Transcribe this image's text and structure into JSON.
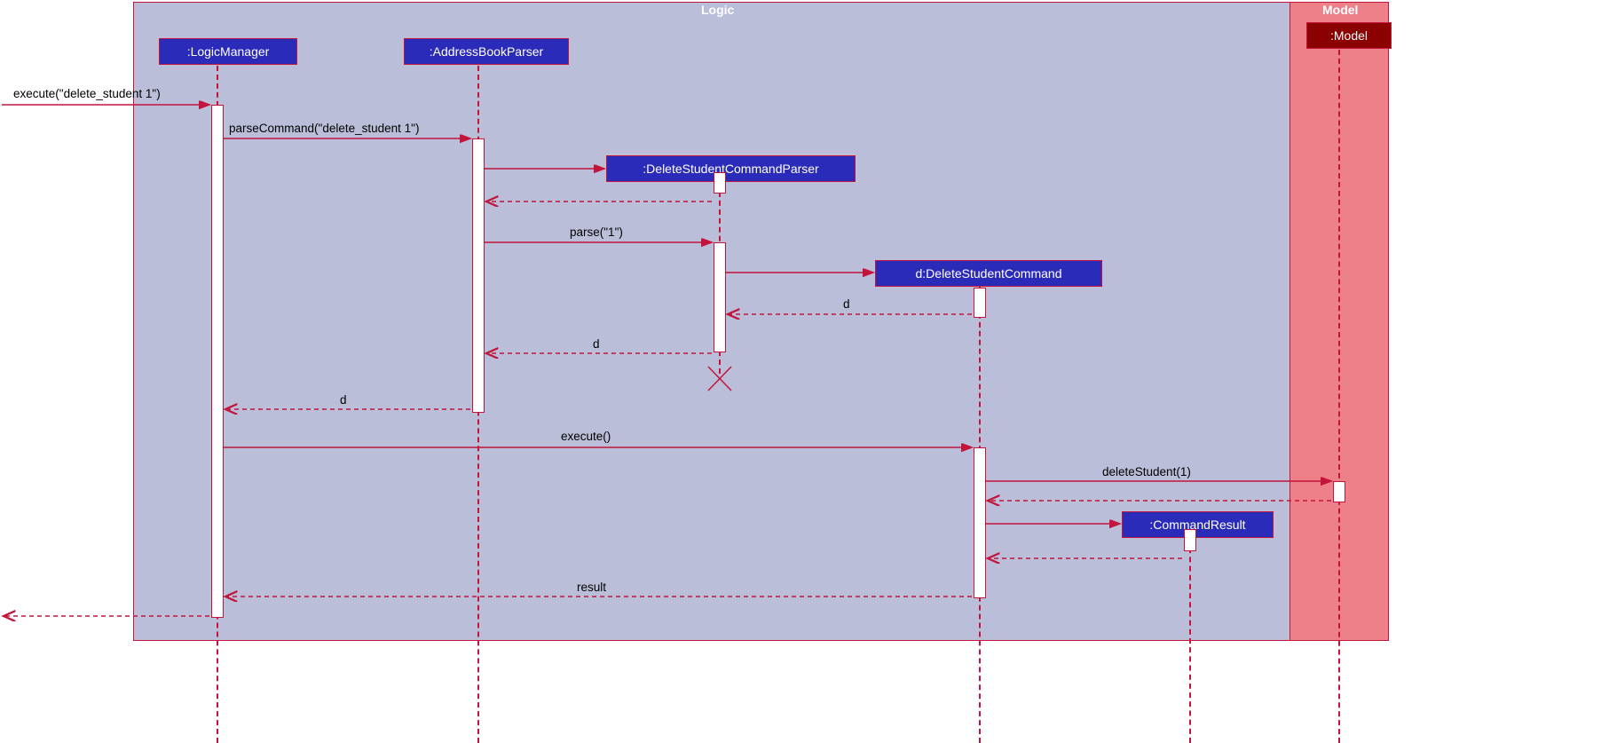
{
  "frames": {
    "logic": "Logic",
    "model": "Model"
  },
  "participants": {
    "logicManager": ":LogicManager",
    "addressBookParser": ":AddressBookParser",
    "deleteStudentCommandParser": ":DeleteStudentCommandParser",
    "deleteStudentCommand": "d:DeleteStudentCommand",
    "commandResult": ":CommandResult",
    "model": ":Model"
  },
  "messages": {
    "execute_in": "execute(\"delete_student 1\")",
    "parseCommand": "parseCommand(\"delete_student 1\")",
    "parse1": "parse(\"1\")",
    "d1": "d",
    "d2": "d",
    "d3": "d",
    "execute": "execute()",
    "deleteStudent": "deleteStudent(1)",
    "result": "result"
  }
}
